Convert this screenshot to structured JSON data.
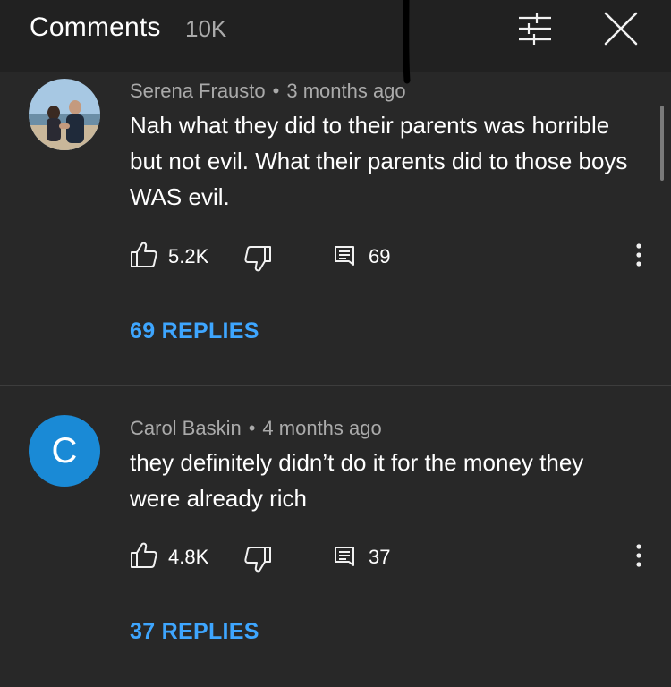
{
  "header": {
    "title": "Comments",
    "count": "10K",
    "filter_icon": "sliders-icon",
    "close_icon": "close-icon"
  },
  "colors": {
    "background": "#282828",
    "header_background": "#212121",
    "link_blue": "#3ea6ff",
    "avatar_blue": "#1a8ad6",
    "meta_gray": "#aaaaaa"
  },
  "comments": [
    {
      "author": "Serena Frausto",
      "separator": "•",
      "time": "3 months ago",
      "text": "Nah what they did to their parents was horrible but not evil. What their parents did to those boys WAS evil.",
      "likes": "5.2K",
      "reply_count": "69",
      "replies_label": "69 REPLIES",
      "avatar": "photo"
    },
    {
      "author": "Carol Baskin",
      "separator": "•",
      "time": "4 months ago",
      "text": "they definitely didn’t do it for the money they were already rich",
      "likes": "4.8K",
      "reply_count": "37",
      "replies_label": "37 REPLIES",
      "avatar": "letter",
      "avatar_letter": "C"
    }
  ]
}
